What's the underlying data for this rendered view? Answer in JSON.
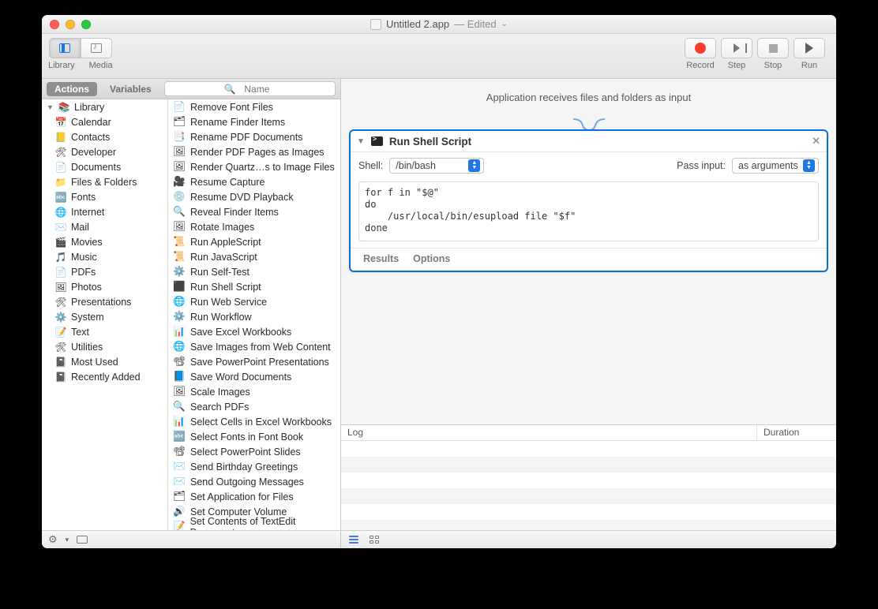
{
  "window": {
    "title_prefix": "Untitled 2.app",
    "title_suffix": "— Edited",
    "dropdown_glyph": "⌄"
  },
  "toolbar": {
    "library": "Library",
    "media": "Media",
    "record": "Record",
    "step": "Step",
    "stop": "Stop",
    "run": "Run"
  },
  "tabs": {
    "actions": "Actions",
    "variables": "Variables"
  },
  "search": {
    "placeholder": "Name"
  },
  "sidebar": {
    "root": "Library",
    "items": [
      {
        "label": "Calendar",
        "icon": "📅"
      },
      {
        "label": "Contacts",
        "icon": "📒"
      },
      {
        "label": "Developer",
        "icon": "🛠"
      },
      {
        "label": "Documents",
        "icon": "📄"
      },
      {
        "label": "Files & Folders",
        "icon": "📁"
      },
      {
        "label": "Fonts",
        "icon": "🔤"
      },
      {
        "label": "Internet",
        "icon": "🌐"
      },
      {
        "label": "Mail",
        "icon": "✉️"
      },
      {
        "label": "Movies",
        "icon": "🎬"
      },
      {
        "label": "Music",
        "icon": "🎵"
      },
      {
        "label": "PDFs",
        "icon": "📄"
      },
      {
        "label": "Photos",
        "icon": "🖼"
      },
      {
        "label": "Presentations",
        "icon": "🛠"
      },
      {
        "label": "System",
        "icon": "⚙️"
      },
      {
        "label": "Text",
        "icon": "📝"
      },
      {
        "label": "Utilities",
        "icon": "🛠"
      }
    ],
    "extra": [
      {
        "label": "Most Used",
        "icon": "📓"
      },
      {
        "label": "Recently Added",
        "icon": "📓"
      }
    ]
  },
  "actions": [
    "Remove Font Files",
    "Rename Finder Items",
    "Rename PDF Documents",
    "Render PDF Pages as Images",
    "Render Quartz…s to Image Files",
    "Resume Capture",
    "Resume DVD Playback",
    "Reveal Finder Items",
    "Rotate Images",
    "Run AppleScript",
    "Run JavaScript",
    "Run Self-Test",
    "Run Shell Script",
    "Run Web Service",
    "Run Workflow",
    "Save Excel Workbooks",
    "Save Images from Web Content",
    "Save PowerPoint Presentations",
    "Save Word Documents",
    "Scale Images",
    "Search PDFs",
    "Select Cells in Excel Workbooks",
    "Select Fonts in Font Book",
    "Select PowerPoint Slides",
    "Send Birthday Greetings",
    "Send Outgoing Messages",
    "Set Application for Files",
    "Set Computer Volume",
    "Set Contents of TextEdit Document"
  ],
  "workflow": {
    "header": "Application receives files and folders as input",
    "card_title": "Run Shell Script",
    "shell_label": "Shell:",
    "shell_value": "/bin/bash",
    "pass_label": "Pass input:",
    "pass_value": "as arguments",
    "code": "for f in \"$@\"\ndo\n    /usr/local/bin/esupload file \"$f\"\ndone",
    "results": "Results",
    "options": "Options"
  },
  "log": {
    "col1": "Log",
    "col2": "Duration"
  }
}
